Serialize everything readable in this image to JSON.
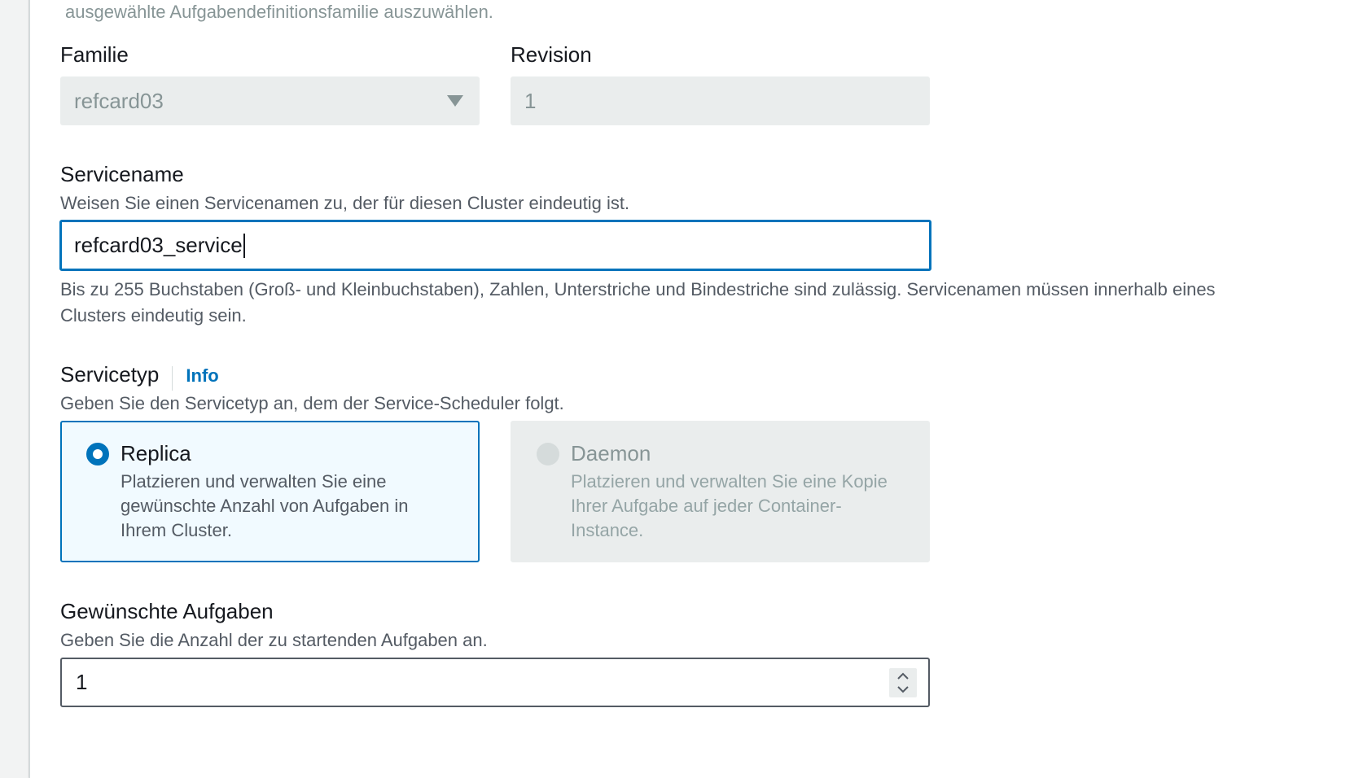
{
  "top_hint": "ausgewählte Aufgabendefinitionsfamilie auszuwählen.",
  "family": {
    "label": "Familie",
    "value": "refcard03"
  },
  "revision": {
    "label": "Revision",
    "value": "1"
  },
  "service_name": {
    "label": "Servicename",
    "description": "Weisen Sie einen Servicenamen zu, der für diesen Cluster eindeutig ist.",
    "value": "refcard03_service",
    "constraint": "Bis zu 255 Buchstaben (Groß- und Kleinbuchstaben), Zahlen, Unterstriche und Bindestriche sind zulässig. Servicenamen müssen innerhalb eines Clusters eindeutig sein."
  },
  "service_type": {
    "label": "Servicetyp",
    "info_link": "Info",
    "description": "Geben Sie den Servicetyp an, dem der Service-Scheduler folgt.",
    "options": [
      {
        "title": "Replica",
        "description": "Platzieren und verwalten Sie eine gewünschte Anzahl von Aufgaben in Ihrem Cluster.",
        "selected": true,
        "disabled": false
      },
      {
        "title": "Daemon",
        "description": "Platzieren und verwalten Sie eine Kopie Ihrer Aufgabe auf jeder Container-Instance.",
        "selected": false,
        "disabled": true
      }
    ]
  },
  "desired_tasks": {
    "label": "Gewünschte Aufgaben",
    "description": "Geben Sie die Anzahl der zu startenden Aufgaben an.",
    "value": "1"
  },
  "colors": {
    "accent": "#0073bb",
    "disabled_bg": "#eaeded",
    "text": "#16191f",
    "muted": "#545b64"
  },
  "icons": {
    "select_caret": "caret-down-icon",
    "stepper": "stepper-icon"
  }
}
